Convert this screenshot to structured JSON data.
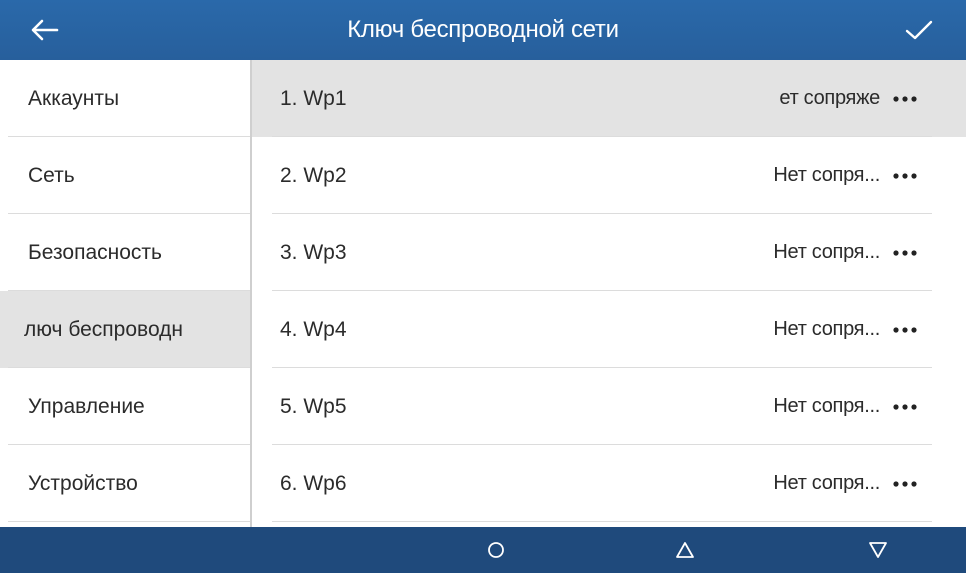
{
  "header": {
    "title": "Ключ беспроводной сети",
    "back_icon": "arrow-left-icon",
    "confirm_icon": "check-icon"
  },
  "sidebar": {
    "items": [
      {
        "label": "Аккаунты"
      },
      {
        "label": "Сеть"
      },
      {
        "label": "Безопасность"
      },
      {
        "label": "люч беспроводн"
      },
      {
        "label": "Управление"
      },
      {
        "label": "Устройство"
      }
    ]
  },
  "list": {
    "rows": [
      {
        "label": "1.  Wp1",
        "status": "ет сопряже"
      },
      {
        "label": "2.  Wp2",
        "status": "Нет сопря..."
      },
      {
        "label": "3.  Wp3",
        "status": "Нет сопря..."
      },
      {
        "label": "4.  Wp4",
        "status": "Нет сопря..."
      },
      {
        "label": "5.  Wp5",
        "status": "Нет сопря..."
      },
      {
        "label": "6.  Wp6",
        "status": "Нет сопря..."
      }
    ]
  },
  "navbar": {
    "icons": [
      "circle-home-icon",
      "triangle-up-icon",
      "triangle-down-icon"
    ]
  },
  "colors": {
    "header_bg": "#2a69aa",
    "navbar_bg": "#1f4a7c",
    "active_row_bg": "#e3e3e3"
  }
}
